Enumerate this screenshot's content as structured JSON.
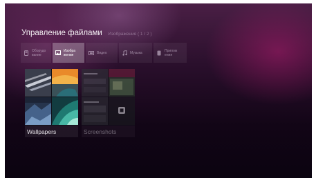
{
  "header": {
    "title": "Управление файлами",
    "subtitle": "Изображения ( 1 / 2 )"
  },
  "tabs": [
    {
      "label": "Оборудо\nвание",
      "icon": "device-icon",
      "active": false
    },
    {
      "label": "Изобра\nжения",
      "icon": "image-icon",
      "active": true
    },
    {
      "label": "Видео",
      "icon": "video-icon",
      "active": false
    },
    {
      "label": "Музыка",
      "icon": "music-icon",
      "active": false
    },
    {
      "label": "Прилож\nения",
      "icon": "app-icon",
      "active": false
    }
  ],
  "folders": [
    {
      "name": "Wallpapers"
    },
    {
      "name": "Screenshots"
    }
  ],
  "colors": {
    "background_top": "#4a1f45",
    "background_bottom": "#0b0410",
    "accent": "#af1c6e"
  }
}
